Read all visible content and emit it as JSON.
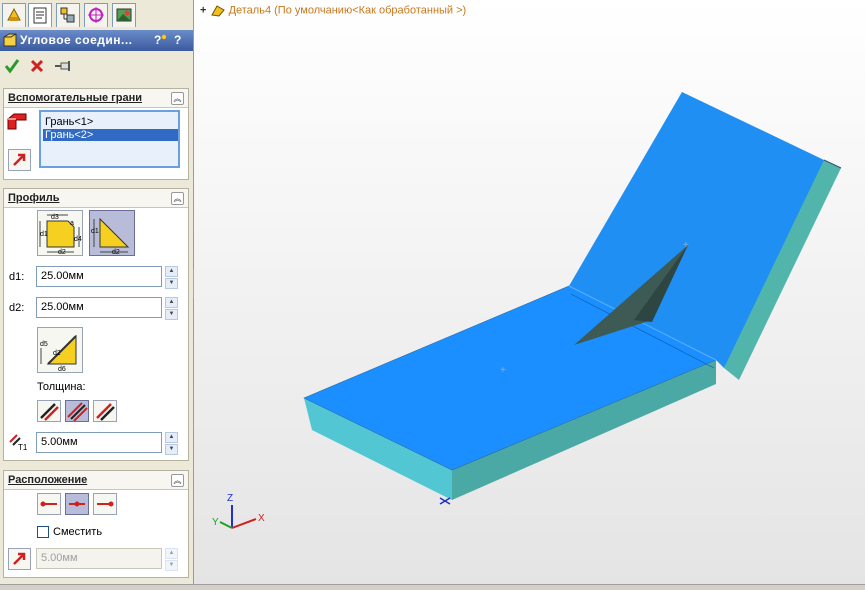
{
  "feature": {
    "title": "Угловое соедин...",
    "help_icon": "?",
    "pin_icon": "pushpin-icon"
  },
  "actions": {
    "ok_icon": "checkmark-icon",
    "cancel_icon": "x-icon",
    "detail_icon": "pushpin-icon"
  },
  "tabs": [
    "feature-manager-icon",
    "property-manager-icon",
    "configuration-manager-icon",
    "dimxpert-icon",
    "display-manager-icon"
  ],
  "supporting_faces": {
    "title": "Вспомогательные грани",
    "items": [
      {
        "label": "Грань<1>",
        "selected": false
      },
      {
        "label": "Грань<2>",
        "selected": true
      }
    ]
  },
  "profile": {
    "title": "Профиль",
    "d1_label": "d1:",
    "d1_value": "25.00мм",
    "d2_label": "d2:",
    "d2_value": "25.00мм",
    "thickness_label": "Толщина:",
    "t1_label": "T1",
    "t1_value": "5.00мм",
    "profile_icon_labels": {
      "d3": "d3",
      "d1": "d1",
      "a": "a",
      "d4": "d4",
      "d2": "d2",
      "d5": "d5",
      "d6": "d6"
    }
  },
  "location": {
    "title": "Расположение",
    "offset_label": "Сместить",
    "offset_checked": false,
    "offset_value": "5.00мм"
  },
  "viewport": {
    "tree_expand": "+",
    "part_name": "Деталь4",
    "config": "(По умолчанию<Как обработанный >)",
    "axes": {
      "x": "X",
      "y": "Y",
      "z": "Z"
    }
  },
  "colors": {
    "face_blue": "#1e90ff",
    "face_top": "#2b8ff2",
    "side_teal": "#4fb8b0",
    "gusset": "#3d5a55",
    "accent": "#316ac5"
  }
}
